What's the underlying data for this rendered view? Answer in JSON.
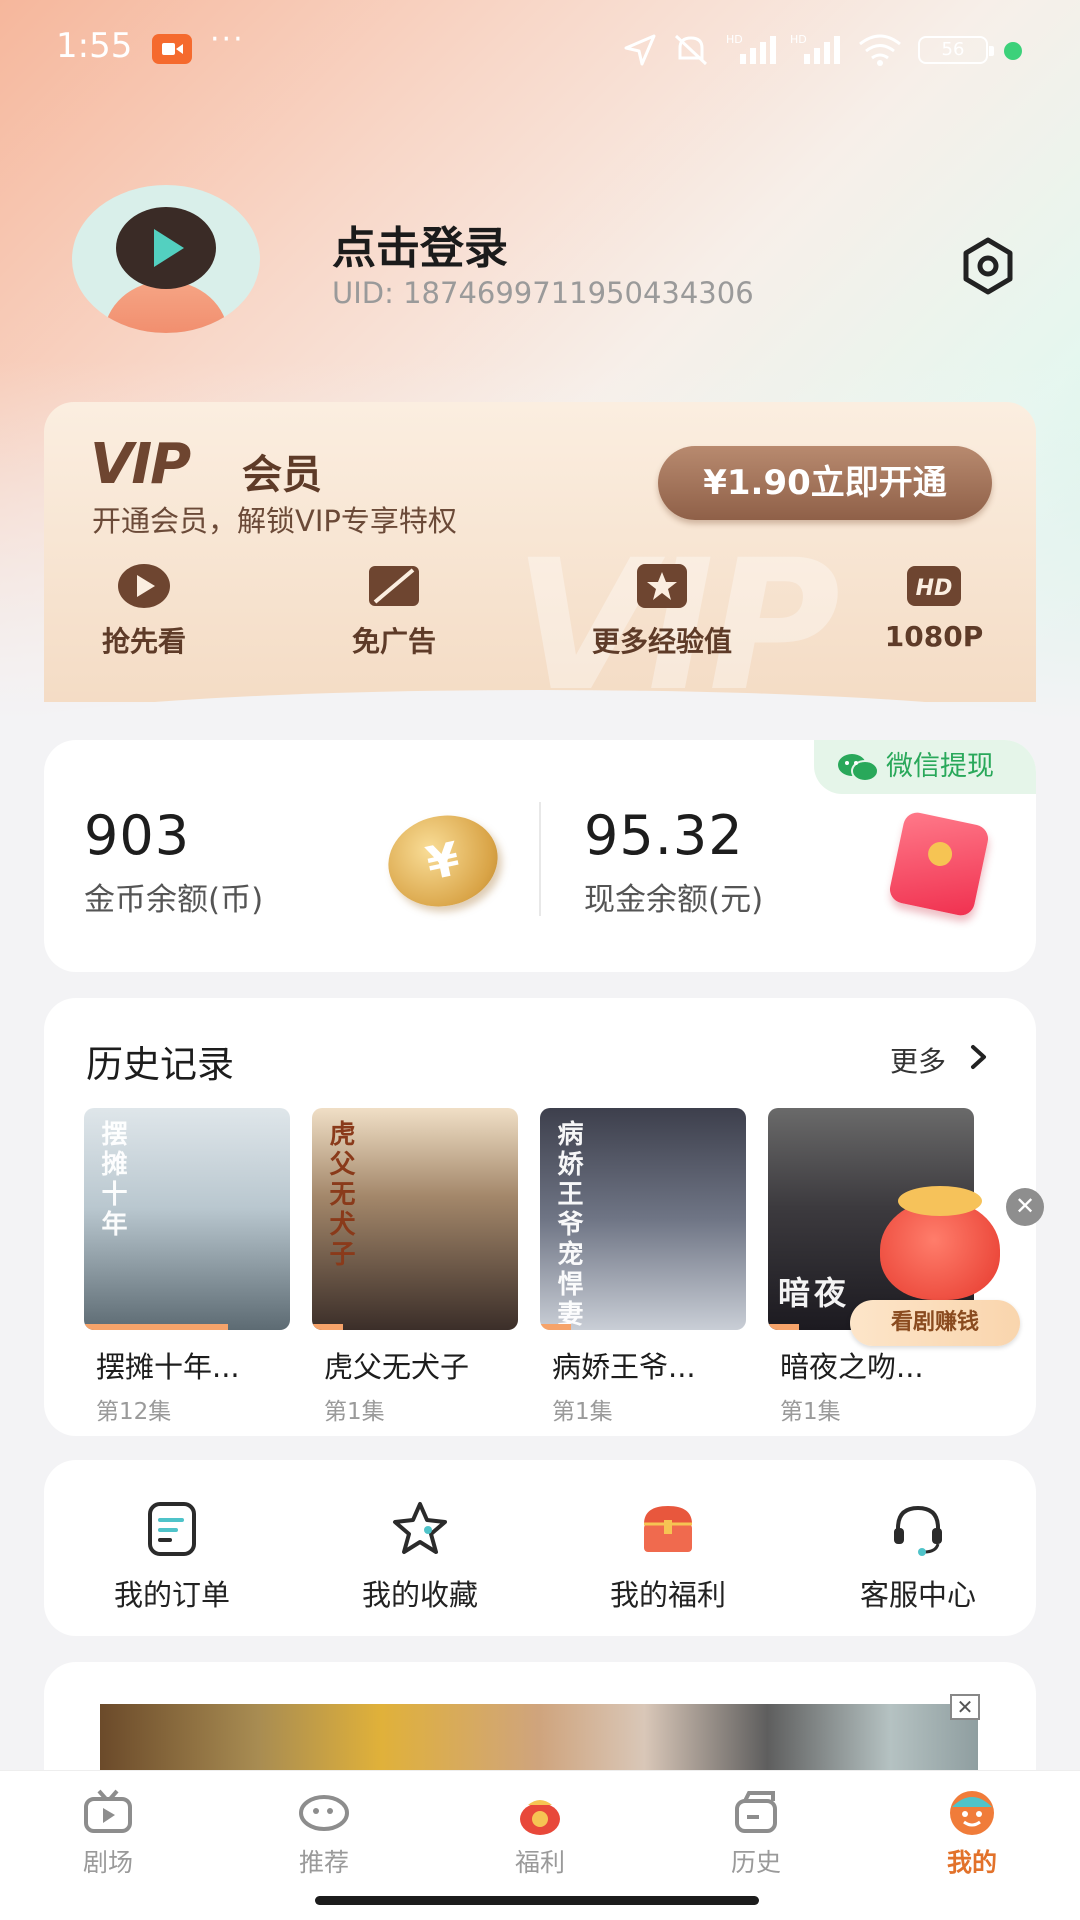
{
  "status_bar": {
    "time": "1:55",
    "more_dots": "···",
    "battery": "56"
  },
  "profile": {
    "login_title": "点击登录",
    "uid": "UID: 1874699711950434306"
  },
  "vip": {
    "logo": "VIP",
    "label": "会员",
    "subtitle": "开通会员，解锁VIP专享特权",
    "open_button": "¥1.90立即开通",
    "perks": [
      {
        "label": "抢先看",
        "icon": "play-circle-icon"
      },
      {
        "label": "免广告",
        "icon": "no-ads-icon"
      },
      {
        "label": "更多经验值",
        "icon": "star-badge-icon"
      },
      {
        "label": "1080P",
        "icon": "hd-icon",
        "icon_text": "HD"
      }
    ]
  },
  "balance": {
    "wechat_withdraw": "微信提现",
    "coin_amount": "903",
    "coin_label": "金币余额(币)",
    "cash_amount": "95.32",
    "cash_label": "现金余额(元)"
  },
  "history": {
    "title": "历史记录",
    "more": "更多",
    "items": [
      {
        "title": "摆摊十年...",
        "episode": "第12集",
        "poster_text": "摆摊十年"
      },
      {
        "title": "虎父无犬子",
        "episode": "第1集",
        "poster_text": "虎父无犬子"
      },
      {
        "title": "病娇王爷...",
        "episode": "第1集",
        "poster_text": "病娇王爷宠悍妻"
      },
      {
        "title": "暗夜之吻...",
        "episode": "第1集",
        "poster_text": "暗夜"
      }
    ],
    "earn_badge": "看剧赚钱",
    "close_glyph": "✕"
  },
  "shortcuts": [
    {
      "label": "我的订单",
      "icon": "order-icon"
    },
    {
      "label": "我的收藏",
      "icon": "star-icon"
    },
    {
      "label": "我的福利",
      "icon": "treasure-chest-icon"
    },
    {
      "label": "客服中心",
      "icon": "headset-icon"
    }
  ],
  "ad": {
    "close_glyph": "✕"
  },
  "tabs": [
    {
      "label": "剧场",
      "icon": "tv-icon",
      "active": false
    },
    {
      "label": "推荐",
      "icon": "chat-bubble-icon",
      "active": false
    },
    {
      "label": "福利",
      "icon": "lucky-bag-icon",
      "active": false
    },
    {
      "label": "历史",
      "icon": "history-icon",
      "active": false
    },
    {
      "label": "我的",
      "icon": "profile-face-icon",
      "active": true
    }
  ],
  "colors": {
    "accent": "#e2722b",
    "vip_button": "#8f6048",
    "wechat_green": "#29a85a"
  }
}
